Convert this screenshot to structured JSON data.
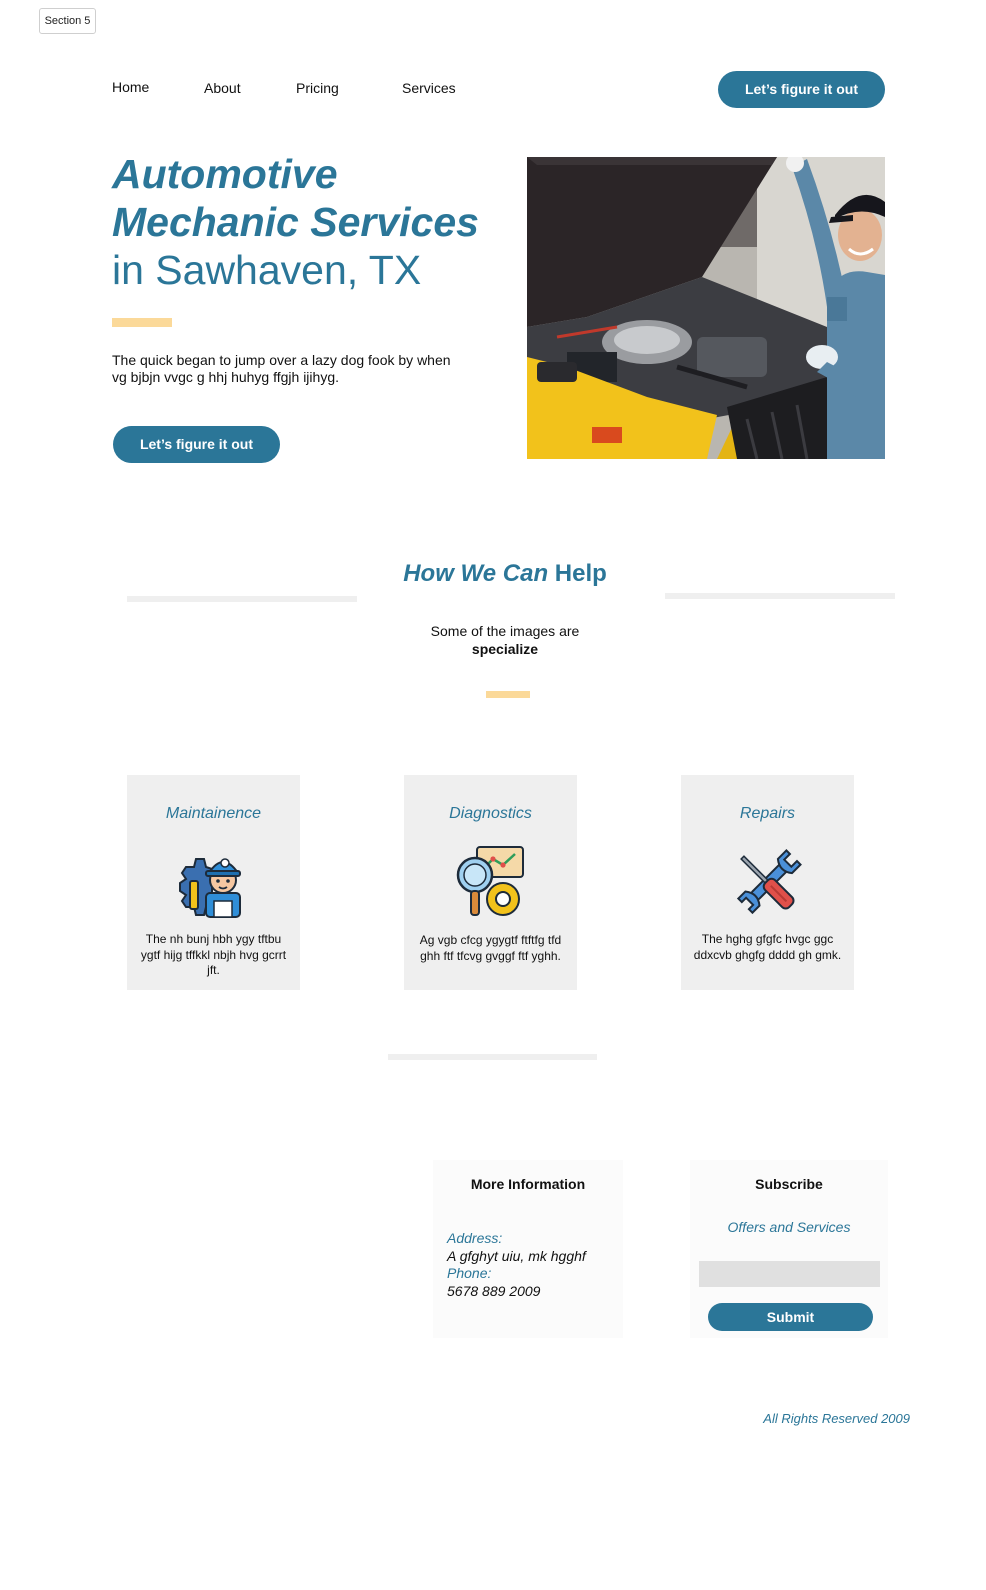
{
  "frame": {
    "label": "Section 5"
  },
  "nav": {
    "items": [
      "Home",
      "About",
      "Pricing",
      "Services"
    ],
    "cta_label": "Let’s figure it out"
  },
  "hero": {
    "title_line_1": "Automotive",
    "title_line_2": "Mechanic Services",
    "title_line_3": "in Sawhaven, TX",
    "description": "The quick began to jump over a lazy dog fook by when vg bjbjn vvgc g hhj huhyg ffgjh ijihyg.",
    "cta_label": "Let’s figure it out",
    "image_icon": "mechanic-photo"
  },
  "help": {
    "title_italic": "How We Can",
    "title_bold": "Help",
    "subtitle_line_1": "Some of the images are",
    "subtitle_line_2": "specialize"
  },
  "services": [
    {
      "title": "Maintainence",
      "icon": "mechanic-gear-icon",
      "text": "The nh bunj hbh ygy tftbu ygtf hijg tffkkl nbjh hvg gcrrt jft."
    },
    {
      "title": "Diagnostics",
      "icon": "diagnostics-magnifier-icon",
      "text": "Ag vgb cfcg ygygtf ftftfg tfd ghh ftf tfcvg gvggf ftf yghh."
    },
    {
      "title": "Repairs",
      "icon": "wrench-screwdriver-icon",
      "text": "The hghg  gfgfc hvgc ggc ddxcvb ghgfg dddd gh gmk."
    }
  ],
  "more_info": {
    "heading": "More Information",
    "address_label": "Address:",
    "address_value": "A gfghyt uiu, mk hgghf",
    "phone_label": "Phone:",
    "phone_value": "5678 889 2009"
  },
  "subscribe": {
    "heading": "Subscribe",
    "subheading": "Offers and Services",
    "input_value": "",
    "button_label": "Submit"
  },
  "footer": {
    "note": "All Rights Reserved 2009"
  },
  "colors": {
    "brand": "#2b7698",
    "accent": "#fbd999",
    "panel": "#efefef"
  }
}
